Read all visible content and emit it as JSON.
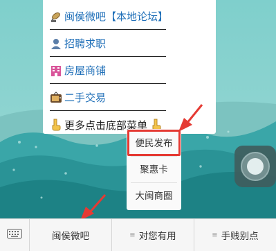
{
  "menu": {
    "items": [
      {
        "icon": "satellite-dish-icon",
        "label": "闽侯微吧【本地论坛】"
      },
      {
        "icon": "person-icon",
        "label": "招聘求职"
      },
      {
        "icon": "building-icon",
        "label": "房屋商铺"
      },
      {
        "icon": "tv-icon",
        "label": "二手交易"
      },
      {
        "icon": "pointing-down-icon",
        "label": "更多点击底部菜单",
        "trailing_icon": "pointing-down-icon"
      }
    ]
  },
  "popup": {
    "items": [
      "便民发布",
      "聚惠卡",
      "大闽商圈"
    ],
    "highlighted": "便民发布"
  },
  "tabbar": {
    "keyboard_icon": "keyboard-icon",
    "tabs": [
      {
        "label": "闽侯微吧",
        "highlighted": true
      },
      {
        "label": "对您有用",
        "menu_icon": "≡"
      },
      {
        "label": "手贱别点",
        "menu_icon": "≡"
      }
    ]
  },
  "colors": {
    "highlight": "#e53a33",
    "link": "#1f6fb8",
    "background": "#7fc9c7"
  }
}
